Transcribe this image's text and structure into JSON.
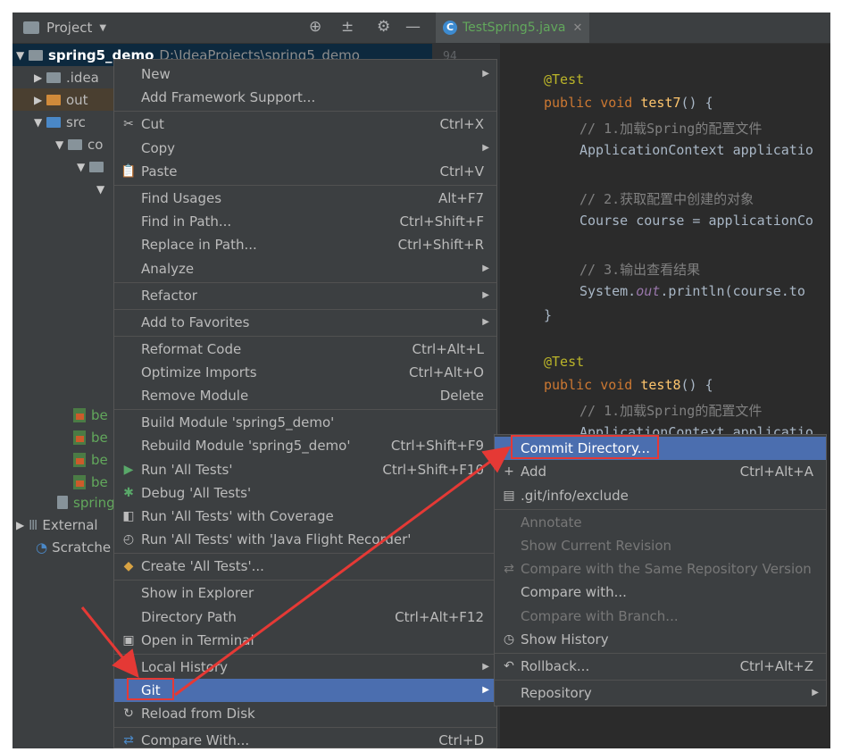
{
  "project_panel": {
    "title": "Project",
    "tree": {
      "root_name": "spring5_demo",
      "root_path": "D:\\IdeaProjects\\spring5_demo",
      "idea": ".idea",
      "out": "out",
      "src": "src",
      "com_partial": "co",
      "bean_partial": "be",
      "spring_partial": "spring",
      "external": "External",
      "scratches": "Scratche"
    }
  },
  "editor": {
    "tab_label": "TestSpring5.java",
    "line_number_partial": "94",
    "code": {
      "annotation": "@Test",
      "kw_public": "public",
      "kw_void": "void",
      "method1": "test7",
      "method2": "test8",
      "paren_brace": "() {",
      "comment1": "// 1.加载Spring的配置文件",
      "line_appctx": "ApplicationContext applicatio",
      "comment2": "// 2.获取配置中创建的对象",
      "line_course": "Course course = applicationCo",
      "comment3": "// 3.输出查看结果",
      "sys_prefix": "System.",
      "sys_out": "out",
      "sys_suffix": ".println(course.to",
      "close_brace": "}"
    }
  },
  "context_menu": {
    "items": [
      {
        "label": "New",
        "submenu": true
      },
      {
        "label": "Add Framework Support..."
      },
      {
        "label": "Cut",
        "shortcut": "Ctrl+X",
        "icon": "scissors-icon"
      },
      {
        "label": "Copy",
        "submenu": true
      },
      {
        "label": "Paste",
        "shortcut": "Ctrl+V",
        "icon": "clipboard-icon"
      },
      {
        "label": "Find Usages",
        "shortcut": "Alt+F7"
      },
      {
        "label": "Find in Path...",
        "shortcut": "Ctrl+Shift+F"
      },
      {
        "label": "Replace in Path...",
        "shortcut": "Ctrl+Shift+R"
      },
      {
        "label": "Analyze",
        "submenu": true
      },
      {
        "label": "Refactor",
        "submenu": true
      },
      {
        "label": "Add to Favorites",
        "submenu": true
      },
      {
        "label": "Reformat Code",
        "shortcut": "Ctrl+Alt+L"
      },
      {
        "label": "Optimize Imports",
        "shortcut": "Ctrl+Alt+O"
      },
      {
        "label": "Remove Module",
        "shortcut": "Delete"
      },
      {
        "label": "Build Module 'spring5_demo'"
      },
      {
        "label": "Rebuild Module 'spring5_demo'",
        "shortcut": "Ctrl+Shift+F9"
      },
      {
        "label": "Run 'All Tests'",
        "shortcut": "Ctrl+Shift+F10",
        "icon": "run-icon"
      },
      {
        "label": "Debug 'All Tests'",
        "icon": "debug-icon"
      },
      {
        "label": "Run 'All Tests' with Coverage",
        "icon": "coverage-icon"
      },
      {
        "label": "Run 'All Tests' with 'Java Flight Recorder'",
        "icon": "profiler-icon"
      },
      {
        "label": "Create 'All Tests'...",
        "icon": "create-config-icon"
      },
      {
        "label": "Show in Explorer"
      },
      {
        "label": "Directory Path",
        "shortcut": "Ctrl+Alt+F12"
      },
      {
        "label": "Open in Terminal",
        "icon": "terminal-icon"
      },
      {
        "label": "Local History",
        "submenu": true
      },
      {
        "label": "Git",
        "submenu": true,
        "selected": true
      },
      {
        "label": "Reload from Disk",
        "icon": "reload-icon"
      },
      {
        "label": "Compare With...",
        "shortcut": "Ctrl+D"
      }
    ]
  },
  "git_submenu": {
    "items": [
      {
        "label": "Commit Directory...",
        "selected": true
      },
      {
        "label": "Add",
        "shortcut": "Ctrl+Alt+A",
        "icon": "plus-icon"
      },
      {
        "label": ".git/info/exclude",
        "icon": "git-file-icon"
      },
      {
        "label": "Annotate",
        "disabled": true
      },
      {
        "label": "Show Current Revision",
        "disabled": true
      },
      {
        "label": "Compare with the Same Repository Version",
        "disabled": true,
        "icon": "compare-icon"
      },
      {
        "label": "Compare with..."
      },
      {
        "label": "Compare with Branch...",
        "disabled": true
      },
      {
        "label": "Show History",
        "icon": "clock-icon"
      },
      {
        "label": "Rollback...",
        "shortcut": "Ctrl+Alt+Z",
        "icon": "rollback-icon"
      },
      {
        "label": "Repository",
        "submenu": true
      }
    ]
  },
  "colors": {
    "accent_selection": "#4b6eaf",
    "annotation_red": "#e53935"
  }
}
